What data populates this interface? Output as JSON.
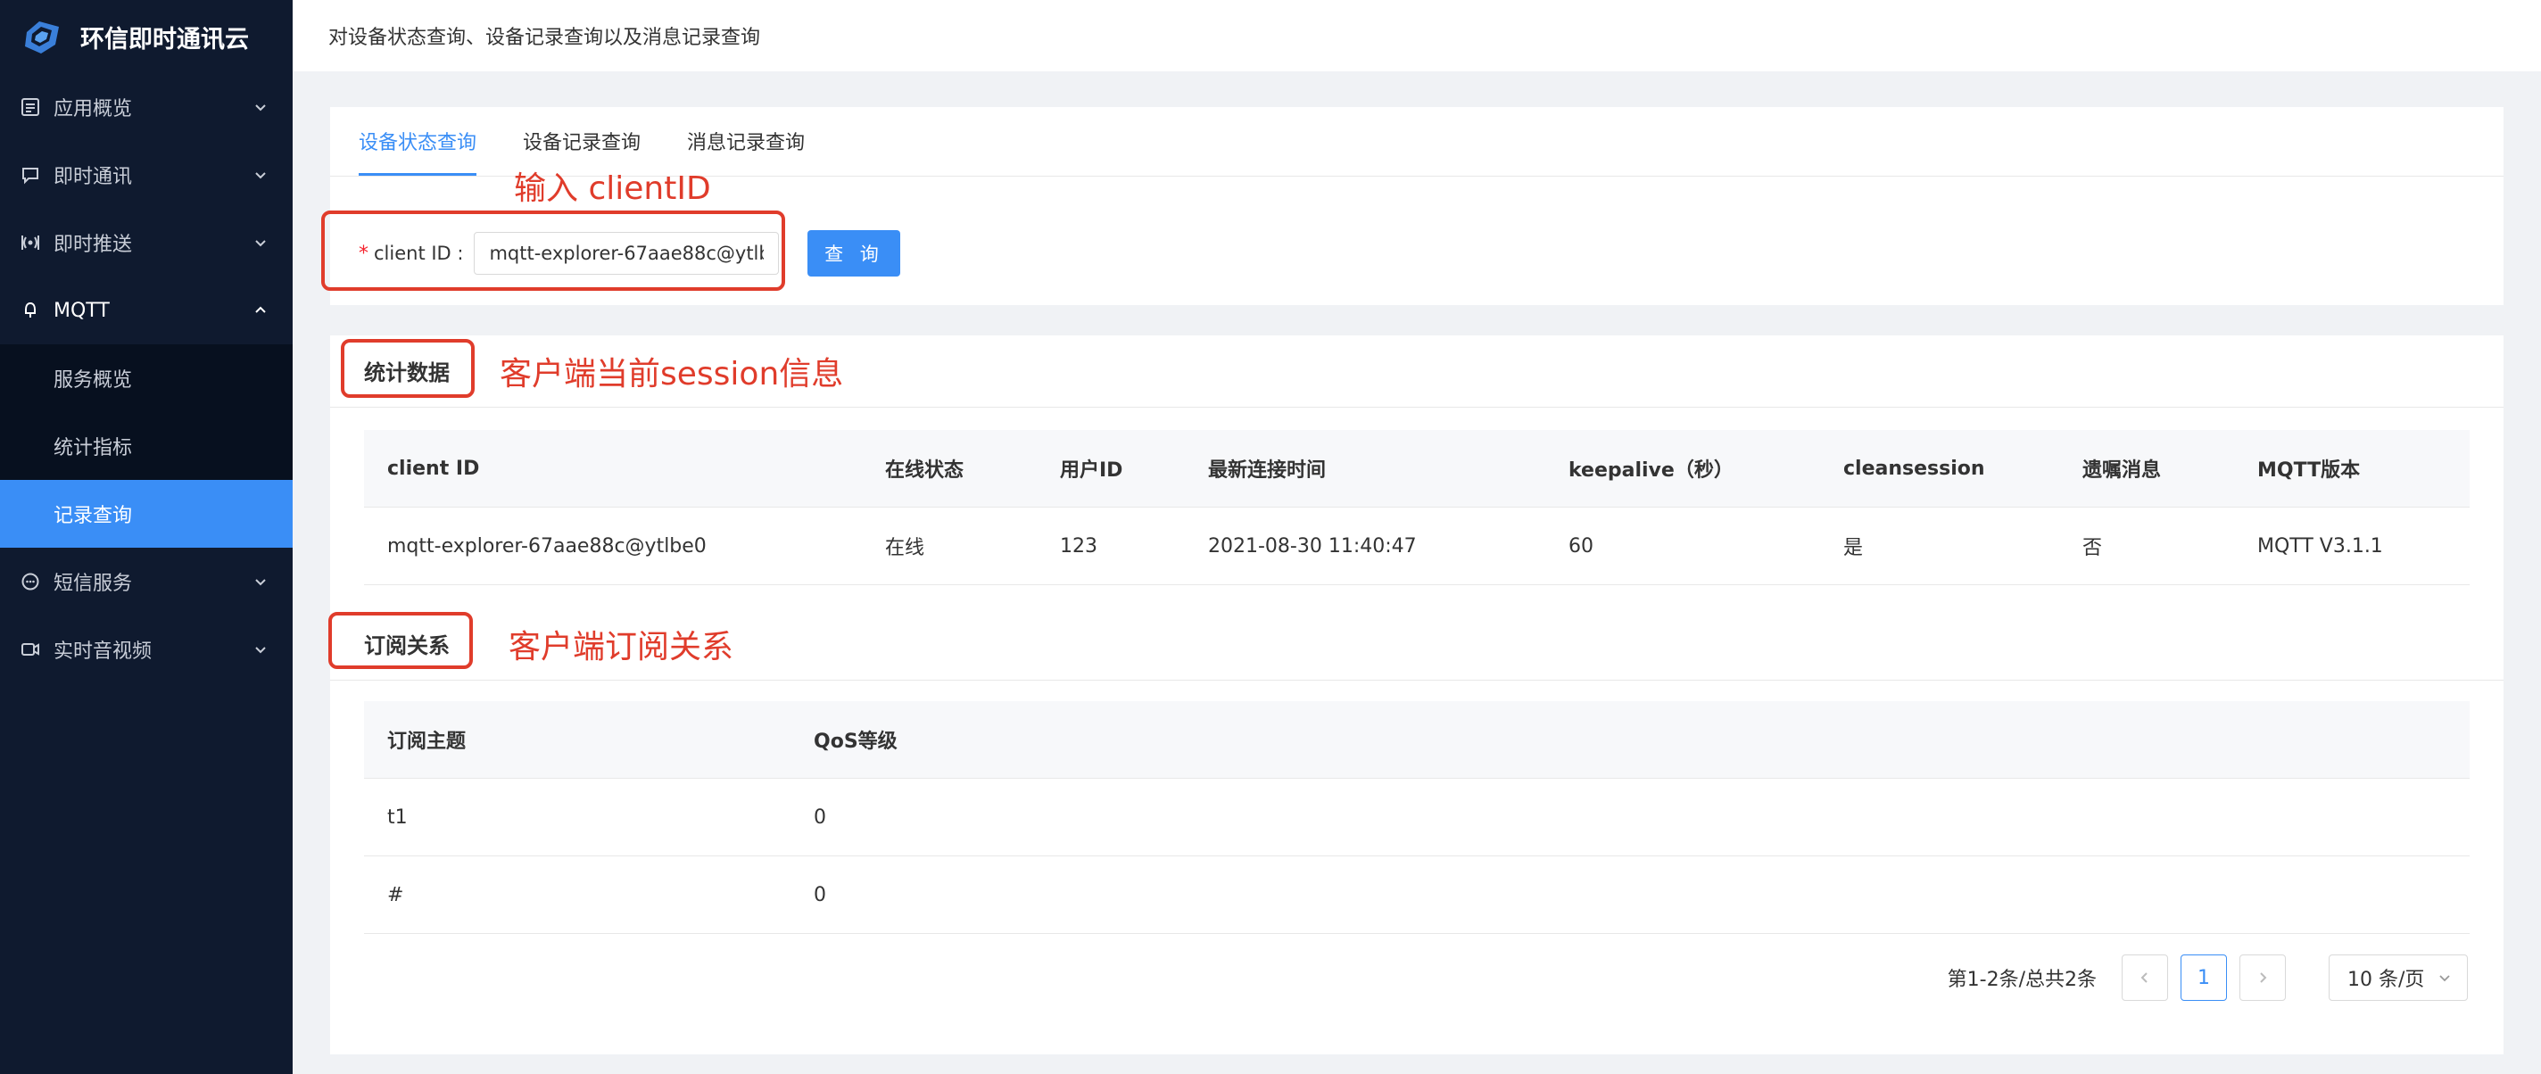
{
  "brand": {
    "title": "环信即时通讯云"
  },
  "sidebar": {
    "items": [
      {
        "label": "应用概览",
        "icon": "list-icon"
      },
      {
        "label": "即时通讯",
        "icon": "chat-icon"
      },
      {
        "label": "即时推送",
        "icon": "broadcast-icon"
      },
      {
        "label": "MQTT",
        "icon": "mqtt-icon"
      },
      {
        "label": "短信服务",
        "icon": "sms-icon"
      },
      {
        "label": "实时音视频",
        "icon": "video-icon"
      }
    ],
    "mqtt_sub": [
      {
        "label": "服务概览"
      },
      {
        "label": "统计指标"
      },
      {
        "label": "记录查询"
      }
    ]
  },
  "header": {
    "title": "对设备状态查询、设备记录查询以及消息记录查询"
  },
  "tabs": [
    {
      "label": "设备状态查询"
    },
    {
      "label": "设备记录查询"
    },
    {
      "label": "消息记录查询"
    }
  ],
  "form": {
    "required_mark": "*",
    "label": "client ID :",
    "value": "mqtt-explorer-67aae88c@ytlbe0",
    "query_button": "查 询"
  },
  "stats": {
    "title": "统计数据",
    "headers": [
      "client ID",
      "在线状态",
      "用户ID",
      "最新连接时间",
      "keepalive（秒）",
      "cleansession",
      "遗嘱消息",
      "MQTT版本"
    ],
    "rows": [
      [
        "mqtt-explorer-67aae88c@ytlbe0",
        "在线",
        "123",
        "2021-08-30 11:40:47",
        "60",
        "是",
        "否",
        "MQTT V3.1.1"
      ]
    ]
  },
  "subs": {
    "title": "订阅关系",
    "headers": [
      "订阅主题",
      "QoS等级"
    ],
    "rows": [
      [
        "t1",
        "0"
      ],
      [
        "#",
        "0"
      ]
    ]
  },
  "pagination": {
    "summary": "第1-2条/总共2条",
    "current_page": "1",
    "page_size": "10 条/页"
  },
  "annotations": {
    "input": "输入 clientID",
    "session": "客户端当前session信息",
    "subscription": "客户端订阅关系"
  },
  "colors": {
    "accent": "#3a8ef6",
    "sidebar": "#0f1a2f",
    "annotation": "#e03c2b"
  }
}
